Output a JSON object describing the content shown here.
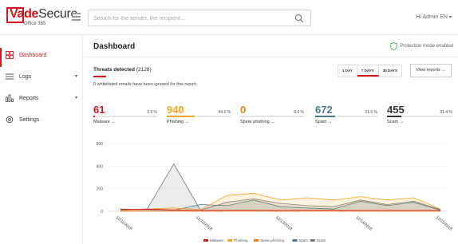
{
  "app": {
    "logo_text_brand": "Vade",
    "logo_text_secure": "Secure",
    "logo_subtitle": "Office 365"
  },
  "search": {
    "placeholder": "Search for the sender, the recipient...",
    "value": ""
  },
  "user": {
    "greeting": "Hi Admin EN"
  },
  "sidebar": {
    "items": [
      {
        "label": "Dashboard",
        "icon": "dashboard-grid-icon",
        "active": true,
        "has_caret": false
      },
      {
        "label": "Logs",
        "icon": "list-icon",
        "active": false,
        "has_caret": true
      },
      {
        "label": "Reports",
        "icon": "bar-chart-icon",
        "active": false,
        "has_caret": true
      },
      {
        "label": "Settings",
        "icon": "gear-icon",
        "active": false,
        "has_caret": false
      }
    ]
  },
  "main": {
    "title": "Dashboard",
    "protection_status": "Protection mode enabled",
    "threats_title": "Threats detected",
    "threats_count": "(2128)",
    "whitelist_note": "0 whitelisted emails have been ignored for this report.",
    "range_tabs": [
      {
        "label": "1 DAY",
        "active": false
      },
      {
        "label": "7 DAYS",
        "active": true
      },
      {
        "label": "30 DAYS",
        "active": false
      }
    ],
    "view_reports_label": "View reports →"
  },
  "stats": [
    {
      "value": "61",
      "percent_label": "2.9 %",
      "percent": 2.9,
      "label": "Malware →",
      "color": "#d7141a"
    },
    {
      "value": "940",
      "percent_label": "44.2 %",
      "percent": 44.2,
      "label": "Phishing →",
      "color": "#f5a623"
    },
    {
      "value": "0",
      "percent_label": "0.0 %",
      "percent": 0.0,
      "label": "Spear phishing →",
      "color": "#f07f13"
    },
    {
      "value": "672",
      "percent_label": "31.6 %",
      "percent": 31.6,
      "label": "Spam →",
      "color": "#4a7a8c"
    },
    {
      "value": "455",
      "percent_label": "21.4 %",
      "percent": 21.4,
      "label": "Scam →",
      "color": "#333333"
    }
  ],
  "chart_data": {
    "type": "area",
    "title": "",
    "xlabel": "",
    "ylabel": "",
    "ylim": [
      0,
      600
    ],
    "yticks": [
      0,
      200,
      400,
      600
    ],
    "x_tick_labels": [
      "12/11/2018",
      "12/12/2018",
      "12/13/2018",
      "12/14/2018",
      "12/15/2018"
    ],
    "x_count": 13,
    "series": [
      {
        "name": "Malware",
        "color": "#d7141a",
        "values": [
          15,
          20,
          12,
          8,
          10,
          10,
          8,
          10,
          10,
          8,
          8,
          8,
          8
        ]
      },
      {
        "name": "Phishing",
        "color": "#f5a623",
        "values": [
          10,
          20,
          30,
          15,
          140,
          160,
          100,
          120,
          100,
          130,
          100,
          120,
          20
        ]
      },
      {
        "name": "Spear phishing",
        "color": "#f07f13",
        "values": [
          0,
          0,
          0,
          0,
          0,
          0,
          0,
          0,
          0,
          0,
          0,
          0,
          0
        ]
      },
      {
        "name": "Spam",
        "color": "#4a7a8c",
        "values": [
          20,
          15,
          10,
          60,
          50,
          100,
          40,
          30,
          20,
          90,
          50,
          80,
          10
        ]
      },
      {
        "name": "Scam",
        "color": "#777777",
        "values": [
          10,
          20,
          420,
          10,
          80,
          110,
          70,
          50,
          40,
          100,
          60,
          90,
          15
        ]
      }
    ],
    "legend_position": "bottom"
  }
}
